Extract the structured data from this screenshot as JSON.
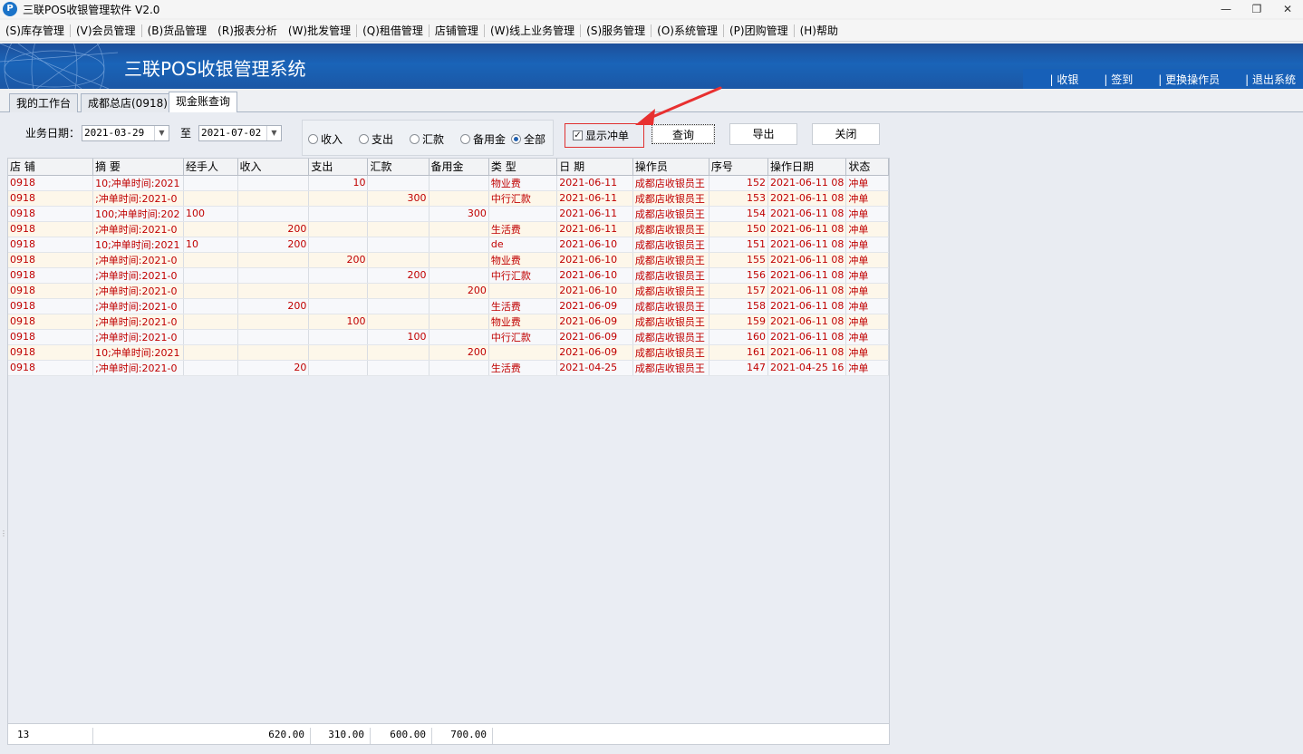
{
  "window": {
    "title": "三联POS收银管理软件 V2.0",
    "icon": "P"
  },
  "menu": [
    "(S)库存管理",
    "(V)会员管理",
    "(B)货品管理",
    "(R)报表分析",
    "(W)批发管理",
    "(Q)租借管理",
    "店铺管理",
    "(W)线上业务管理",
    "(S)服务管理",
    "(O)系统管理",
    "(P)团购管理",
    "(H)帮助"
  ],
  "banner": {
    "title": "三联POS收银管理系统",
    "links": [
      "收银",
      "签到",
      "更换操作员",
      "退出系统"
    ]
  },
  "tabs": [
    "我的工作台",
    "成都总店(0918)",
    "现金账查询"
  ],
  "filter": {
    "date_label": "业务日期：",
    "date_from": "2021-03-29",
    "to_label": "至",
    "date_to": "2021-07-02",
    "radios": [
      "收入",
      "支出",
      "汇款",
      "备用金",
      "全部"
    ],
    "radio_selected": "全部",
    "checkbox_label": "显示冲单",
    "checkbox_checked": true,
    "buttons": {
      "query": "查询",
      "export": "导出",
      "close": "关闭"
    }
  },
  "table": {
    "columns": [
      "店 铺",
      "摘 要",
      "经手人",
      "收入",
      "支出",
      "汇款",
      "备用金",
      "类 型",
      "日 期",
      "操作员",
      "序号",
      "操作日期",
      "状态"
    ],
    "rows": [
      [
        "0918",
        "10;冲单时间:2021",
        "",
        "",
        "10",
        "",
        "",
        "物业费",
        "2021-06-11",
        "成都店收银员王",
        "152",
        "2021-06-11 08",
        "冲单"
      ],
      [
        "0918",
        ";冲单时间:2021-0",
        "",
        "",
        "",
        "300",
        "",
        "中行汇款",
        "2021-06-11",
        "成都店收银员王",
        "153",
        "2021-06-11 08",
        "冲单"
      ],
      [
        "0918",
        "100;冲单时间:202",
        "100",
        "",
        "",
        "",
        "300",
        "",
        "2021-06-11",
        "成都店收银员王",
        "154",
        "2021-06-11 08",
        "冲单"
      ],
      [
        "0918",
        ";冲单时间:2021-0",
        "",
        "200",
        "",
        "",
        "",
        "生活费",
        "2021-06-11",
        "成都店收银员王",
        "150",
        "2021-06-11 08",
        "冲单"
      ],
      [
        "0918",
        "10;冲单时间:2021",
        "10",
        "200",
        "",
        "",
        "",
        "de",
        "2021-06-10",
        "成都店收银员王",
        "151",
        "2021-06-11 08",
        "冲单"
      ],
      [
        "0918",
        ";冲单时间:2021-0",
        "",
        "",
        "200",
        "",
        "",
        "物业费",
        "2021-06-10",
        "成都店收银员王",
        "155",
        "2021-06-11 08",
        "冲单"
      ],
      [
        "0918",
        ";冲单时间:2021-0",
        "",
        "",
        "",
        "200",
        "",
        "中行汇款",
        "2021-06-10",
        "成都店收银员王",
        "156",
        "2021-06-11 08",
        "冲单"
      ],
      [
        "0918",
        ";冲单时间:2021-0",
        "",
        "",
        "",
        "",
        "200",
        "",
        "2021-06-10",
        "成都店收银员王",
        "157",
        "2021-06-11 08",
        "冲单"
      ],
      [
        "0918",
        ";冲单时间:2021-0",
        "",
        "200",
        "",
        "",
        "",
        "生活费",
        "2021-06-09",
        "成都店收银员王",
        "158",
        "2021-06-11 08",
        "冲单"
      ],
      [
        "0918",
        ";冲单时间:2021-0",
        "",
        "",
        "100",
        "",
        "",
        "物业费",
        "2021-06-09",
        "成都店收银员王",
        "159",
        "2021-06-11 08",
        "冲单"
      ],
      [
        "0918",
        ";冲单时间:2021-0",
        "",
        "",
        "",
        "100",
        "",
        "中行汇款",
        "2021-06-09",
        "成都店收银员王",
        "160",
        "2021-06-11 08",
        "冲单"
      ],
      [
        "0918",
        "10;冲单时间:2021",
        "",
        "",
        "",
        "",
        "200",
        "",
        "2021-06-09",
        "成都店收银员王",
        "161",
        "2021-06-11 08",
        "冲单"
      ],
      [
        "0918",
        ";冲单时间:2021-0",
        "",
        "20",
        "",
        "",
        "",
        "生活费",
        "2021-04-25",
        "成都店收银员王",
        "147",
        "2021-04-25 16",
        "冲单"
      ]
    ]
  },
  "summary": {
    "count": "13",
    "income": "620.00",
    "expense": "310.00",
    "remit": "600.00",
    "reserve": "700.00"
  }
}
